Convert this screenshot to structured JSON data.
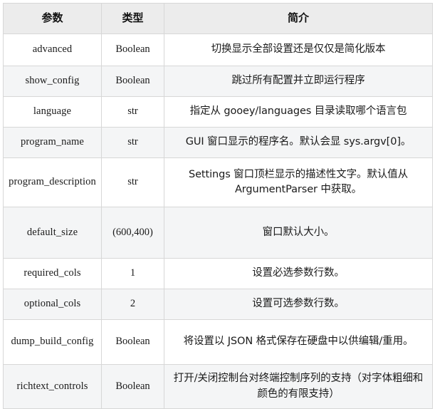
{
  "table": {
    "headers": [
      {
        "label": "参数"
      },
      {
        "label": "类型"
      },
      {
        "label": "简介"
      }
    ],
    "rows": [
      {
        "param": "advanced",
        "type": "Boolean",
        "desc": "切换显示全部设置还是仅仅是简化版本"
      },
      {
        "param": "show_config",
        "type": "Boolean",
        "desc": "跳过所有配置并立即运行程序"
      },
      {
        "param": "language",
        "type": "str",
        "desc": "指定从 gooey/languages 目录读取哪个语言包"
      },
      {
        "param": "program_name",
        "type": "str",
        "desc": "GUI 窗口显示的程序名。默认会显 sys.argv[0]。"
      },
      {
        "param": "program_description",
        "type": "str",
        "desc": "Settings 窗口顶栏显示的描述性文字。默认值从 ArgumentParser 中获取。"
      },
      {
        "param": "default_size",
        "type": "(600,400)",
        "desc": "窗口默认大小。"
      },
      {
        "param": "required_cols",
        "type": "1",
        "desc": "设置必选参数行数。"
      },
      {
        "param": "optional_cols",
        "type": "2",
        "desc": "设置可选参数行数。"
      },
      {
        "param": "dump_build_config",
        "type": "Boolean",
        "desc": "将设置以 JSON 格式保存在硬盘中以供编辑/重用。"
      },
      {
        "param": "richtext_controls",
        "type": "Boolean",
        "desc": "打开/关闭控制台对终端控制序列的支持（对字体粗细和颜色的有限支持）"
      }
    ]
  }
}
